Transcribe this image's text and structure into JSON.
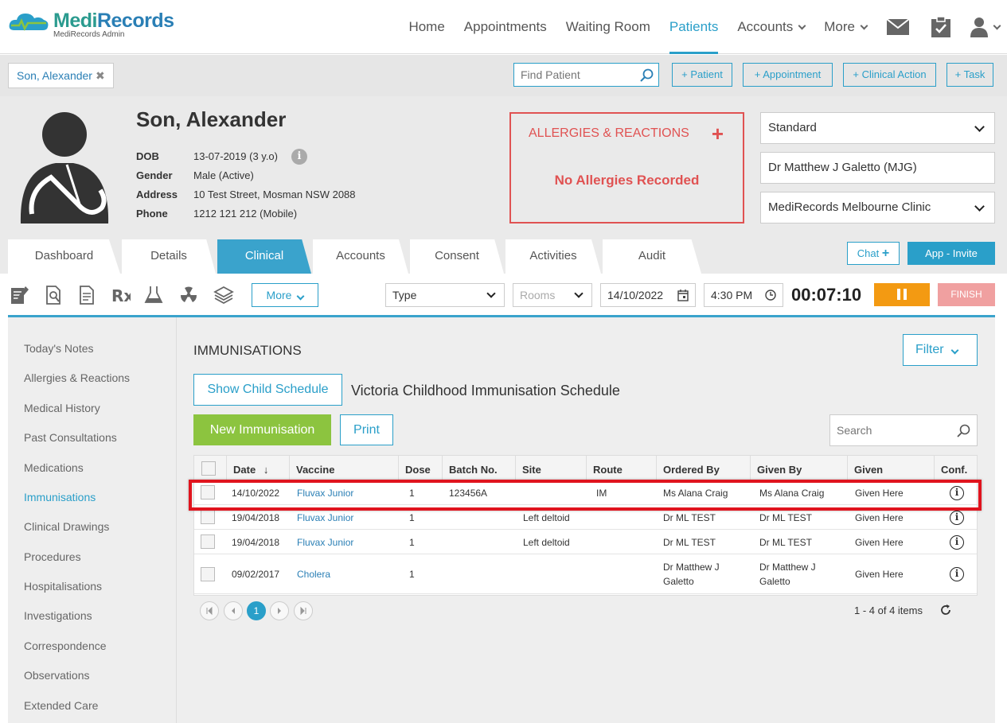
{
  "app": {
    "logo_main": "MediRecords",
    "logo_main_a": "Medi",
    "logo_main_b": "Records",
    "logo_sub": "MediRecords Admin"
  },
  "nav": {
    "items": [
      {
        "label": "Home"
      },
      {
        "label": "Appointments"
      },
      {
        "label": "Waiting Room"
      },
      {
        "label": "Patients",
        "active": true
      },
      {
        "label": "Accounts"
      },
      {
        "label": "More"
      }
    ],
    "icons": [
      "mail-icon",
      "clipboard-check-icon",
      "user-icon"
    ]
  },
  "subbar": {
    "patient_tab": "Son, Alexander",
    "find_patient_placeholder": "Find Patient",
    "buttons": [
      "+ Patient",
      "+ Appointment",
      "+ Clinical Action",
      "+ Task"
    ]
  },
  "patient": {
    "name": "Son, Alexander",
    "fields": [
      {
        "label": "DOB",
        "value": "13-07-2019 (3 y.o)"
      },
      {
        "label": "Gender",
        "value": "Male (Active)"
      },
      {
        "label": "Address",
        "value": "10 Test Street, Mosman NSW 2088"
      },
      {
        "label": "Phone",
        "value": "1212 121 212 (Mobile)"
      }
    ],
    "allergies_title": "ALLERGIES & REACTIONS",
    "allergies_status": "No Allergies Recorded",
    "selectors": {
      "appointment_type": "Standard",
      "doctor": "Dr Matthew J Galetto (MJG)",
      "clinic": "MediRecords Melbourne Clinic"
    }
  },
  "tabs": [
    {
      "label": "Dashboard"
    },
    {
      "label": "Details"
    },
    {
      "label": "Clinical",
      "active": true
    },
    {
      "label": "Accounts"
    },
    {
      "label": "Consent"
    },
    {
      "label": "Activities"
    },
    {
      "label": "Audit"
    }
  ],
  "tab_actions": {
    "chat": "Chat",
    "invite": "App - Invite"
  },
  "toolbar": {
    "icons": [
      "notes-icon",
      "document-search-icon",
      "document-icon",
      "prescription-icon",
      "lab-flask-icon",
      "radiation-icon",
      "stack-icon"
    ],
    "more_label": "More",
    "type_label": "Type",
    "rooms_placeholder": "Rooms",
    "date": "14/10/2022",
    "time": "4:30 PM",
    "timer": "00:07:10",
    "finish_label": "FINISH"
  },
  "sidebar": {
    "items": [
      {
        "label": "Today's Notes"
      },
      {
        "label": "Allergies & Reactions"
      },
      {
        "label": "Medical History"
      },
      {
        "label": "Past Consultations"
      },
      {
        "label": "Medications"
      },
      {
        "label": "Immunisations",
        "active": true
      },
      {
        "label": "Clinical Drawings"
      },
      {
        "label": "Procedures"
      },
      {
        "label": "Hospitalisations"
      },
      {
        "label": "Investigations"
      },
      {
        "label": "Correspondence"
      },
      {
        "label": "Observations"
      },
      {
        "label": "Extended Care"
      }
    ]
  },
  "immunisations": {
    "title": "IMMUNISATIONS",
    "filter_label": "Filter",
    "show_schedule_label": "Show Child Schedule",
    "schedule_name": "Victoria Childhood Immunisation Schedule",
    "new_label": "New Immunisation",
    "print_label": "Print",
    "search_placeholder": "Search",
    "columns": [
      "Date",
      "Vaccine",
      "Dose",
      "Batch No.",
      "Site",
      "Route",
      "Ordered By",
      "Given By",
      "Given",
      "Conf."
    ],
    "rows": [
      {
        "date": "14/10/2022",
        "vaccine": "Fluvax Junior",
        "dose": "1",
        "batch": "123456A",
        "site": "",
        "route": "IM",
        "ordered_by": "Ms Alana Craig",
        "given_by": "Ms Alana Craig",
        "given": "Given Here",
        "highlighted": true
      },
      {
        "date": "19/04/2018",
        "vaccine": "Fluvax Junior",
        "dose": "1",
        "batch": "",
        "site": "Left deltoid",
        "route": "",
        "ordered_by": "Dr ML TEST",
        "given_by": "Dr ML TEST",
        "given": "Given Here"
      },
      {
        "date": "19/04/2018",
        "vaccine": "Fluvax Junior",
        "dose": "1",
        "batch": "",
        "site": "Left deltoid",
        "route": "",
        "ordered_by": "Dr ML TEST",
        "given_by": "Dr ML TEST",
        "given": "Given Here"
      },
      {
        "date": "09/02/2017",
        "vaccine": "Cholera",
        "dose": "1",
        "batch": "",
        "site": "",
        "route": "",
        "ordered_by": "Dr Matthew J Galetto",
        "given_by": "Dr Matthew J Galetto",
        "given": "Given Here"
      }
    ],
    "pager": {
      "current_page": "1",
      "summary": "1 - 4 of 4 items"
    }
  },
  "colors": {
    "accent": "#2a9fc9",
    "alert": "#e05252",
    "success": "#8cc43f",
    "warning": "#f39a12"
  }
}
